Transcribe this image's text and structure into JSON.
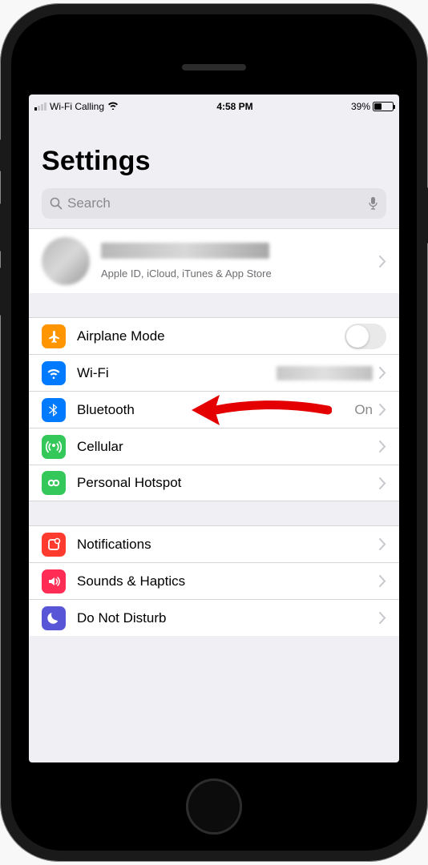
{
  "status": {
    "carrier": "Wi-Fi Calling",
    "time": "4:58 PM",
    "battery_pct": "39%",
    "battery_fill_pct": 39
  },
  "header": {
    "title": "Settings"
  },
  "search": {
    "placeholder": "Search"
  },
  "account": {
    "name": "[redacted]",
    "subtitle": "Apple ID, iCloud, iTunes & App Store"
  },
  "rows": {
    "airplane": {
      "label": "Airplane Mode",
      "icon_color": "#ff9500"
    },
    "wifi": {
      "label": "Wi-Fi",
      "value": "[redacted]",
      "icon_color": "#007aff"
    },
    "bluetooth": {
      "label": "Bluetooth",
      "value": "On",
      "icon_color": "#007aff"
    },
    "cellular": {
      "label": "Cellular",
      "icon_color": "#34c759"
    },
    "hotspot": {
      "label": "Personal Hotspot",
      "icon_color": "#34c759"
    },
    "notifications": {
      "label": "Notifications",
      "icon_color": "#ff3b30"
    },
    "sounds": {
      "label": "Sounds & Haptics",
      "icon_color": "#ff2d55"
    },
    "dnd": {
      "label": "Do Not Disturb",
      "icon_color": "#5856d6"
    }
  },
  "annotation": {
    "target": "bluetooth"
  }
}
